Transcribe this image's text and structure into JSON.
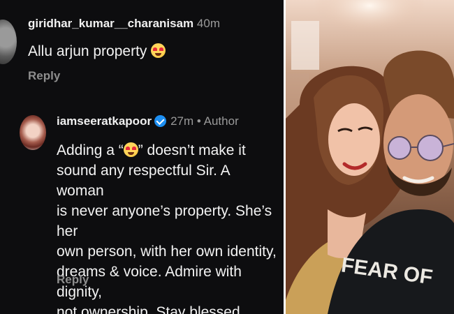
{
  "comments": [
    {
      "username": "giridhar_kumar__charanisam",
      "time": "40m",
      "author_tag": "",
      "text_parts": [
        "Allu arjun property "
      ],
      "emoji": "heart-eyes-emoji",
      "reply_label": "Reply"
    },
    {
      "username": "iamseeratkapoor",
      "verified": true,
      "time": "27m",
      "separator": "•",
      "author_tag": "Author",
      "text_lines": [
        "Adding a “",
        "” doesn’t make it",
        "sound any respectful Sir. A woman",
        "is never anyone’s property. She’s her",
        "own person, with her own identity,",
        "dreams & voice. Admire with dignity,",
        "not ownership. Stay blessed"
      ],
      "emoji": "heart-eyes-emoji",
      "reply_label": "Reply"
    }
  ],
  "photo": {
    "shirt_text": "FEAR OF",
    "colors": {
      "background": "#0d0d0f",
      "text": "#f3f3f3",
      "meta": "#9a9a9a",
      "verified": "#1d8ff2"
    }
  }
}
